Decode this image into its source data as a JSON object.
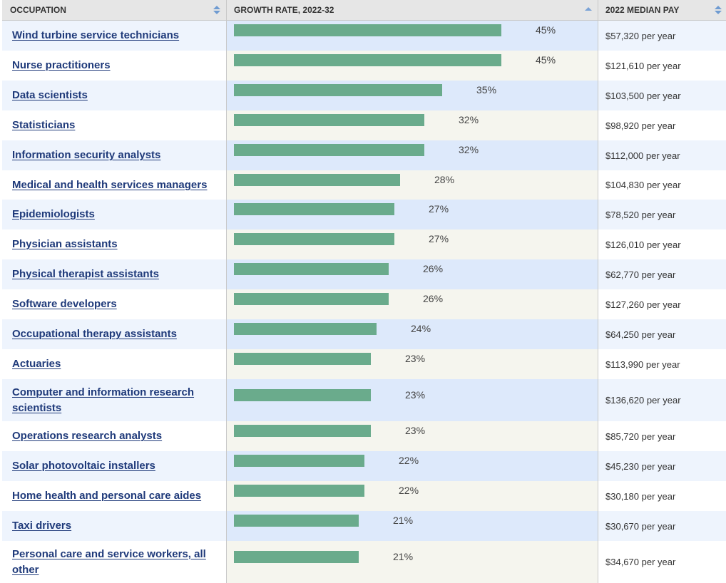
{
  "table": {
    "headers": {
      "occupation": "OCCUPATION",
      "growth": "GROWTH RATE, 2022-32",
      "pay": "2022 MEDIAN PAY"
    },
    "max_rate": 45,
    "rows": [
      {
        "occupation": "Wind turbine service technicians",
        "rate": 45,
        "rate_label": "45%",
        "pay": "$57,320 per year"
      },
      {
        "occupation": "Nurse practitioners",
        "rate": 45,
        "rate_label": "45%",
        "pay": "$121,610 per year"
      },
      {
        "occupation": "Data scientists",
        "rate": 35,
        "rate_label": "35%",
        "pay": "$103,500 per year"
      },
      {
        "occupation": "Statisticians",
        "rate": 32,
        "rate_label": "32%",
        "pay": "$98,920 per year"
      },
      {
        "occupation": "Information security analysts",
        "rate": 32,
        "rate_label": "32%",
        "pay": "$112,000 per year"
      },
      {
        "occupation": "Medical and health services managers",
        "rate": 28,
        "rate_label": "28%",
        "pay": "$104,830 per year"
      },
      {
        "occupation": "Epidemiologists",
        "rate": 27,
        "rate_label": "27%",
        "pay": "$78,520 per year"
      },
      {
        "occupation": "Physician assistants",
        "rate": 27,
        "rate_label": "27%",
        "pay": "$126,010 per year"
      },
      {
        "occupation": "Physical therapist assistants",
        "rate": 26,
        "rate_label": "26%",
        "pay": "$62,770 per year"
      },
      {
        "occupation": "Software developers",
        "rate": 26,
        "rate_label": "26%",
        "pay": "$127,260 per year"
      },
      {
        "occupation": "Occupational therapy assistants",
        "rate": 24,
        "rate_label": "24%",
        "pay": "$64,250 per year"
      },
      {
        "occupation": "Actuaries",
        "rate": 23,
        "rate_label": "23%",
        "pay": "$113,990 per year"
      },
      {
        "occupation": "Computer and information research scientists",
        "rate": 23,
        "rate_label": "23%",
        "pay": "$136,620 per year"
      },
      {
        "occupation": "Operations research analysts",
        "rate": 23,
        "rate_label": "23%",
        "pay": "$85,720 per year"
      },
      {
        "occupation": "Solar photovoltaic installers",
        "rate": 22,
        "rate_label": "22%",
        "pay": "$45,230 per year"
      },
      {
        "occupation": "Home health and personal care aides",
        "rate": 22,
        "rate_label": "22%",
        "pay": "$30,180 per year"
      },
      {
        "occupation": "Taxi drivers",
        "rate": 21,
        "rate_label": "21%",
        "pay": "$30,670 per year"
      },
      {
        "occupation": "Personal care and service workers, all other",
        "rate": 21,
        "rate_label": "21%",
        "pay": "$34,670 per year"
      }
    ]
  },
  "colors": {
    "bar": "#6aab8c",
    "link": "#1f3a7a",
    "sort_arrow": "#6f9bd1"
  }
}
